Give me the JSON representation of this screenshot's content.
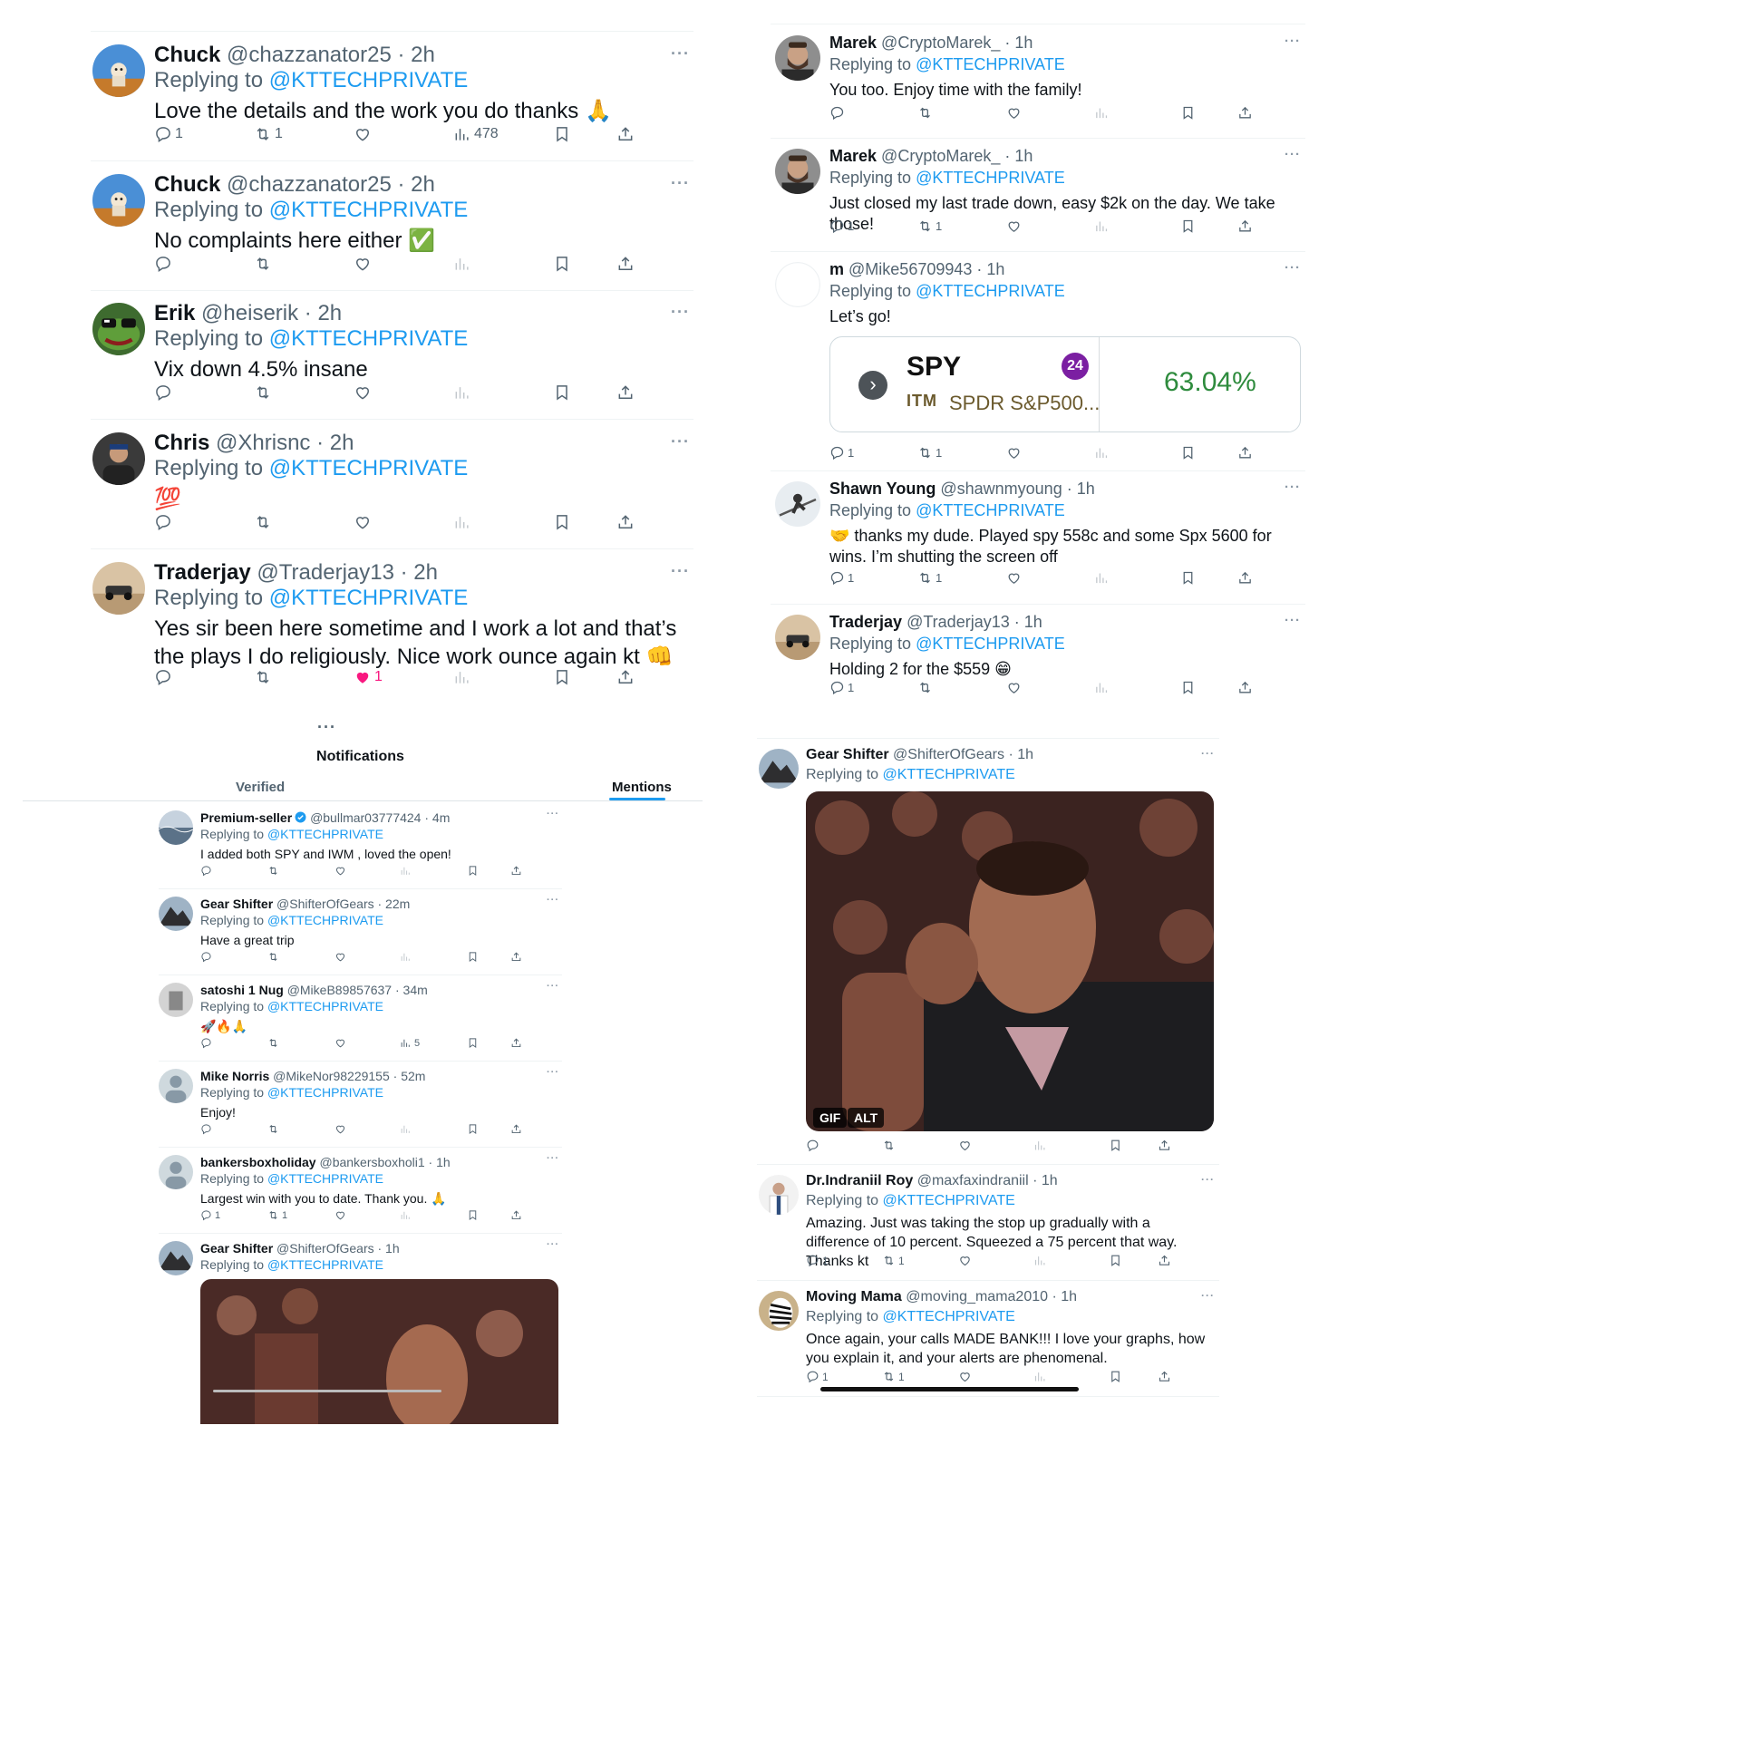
{
  "reply_prefix": "Replying to",
  "mention": "@KTTECHPRIVATE",
  "left_top": [
    {
      "name": "Chuck",
      "handle": "@chazzanator25 · 2h",
      "text": "Love the details and the work you do thanks 🙏",
      "replies": "1",
      "reposts": "1",
      "likes": "",
      "views": "478"
    },
    {
      "name": "Chuck",
      "handle": "@chazzanator25 · 2h",
      "text": "No complaints here either ✅",
      "replies": "",
      "reposts": "",
      "likes": "",
      "views": ""
    },
    {
      "name": "Erik",
      "handle": "@heiserik · 2h",
      "text": "Vix down 4.5% insane",
      "replies": "",
      "reposts": "",
      "likes": "",
      "views": ""
    },
    {
      "name": "Chris",
      "handle": "@Xhrisnc · 2h",
      "text": "💯",
      "replies": "",
      "reposts": "",
      "likes": "",
      "views": ""
    },
    {
      "name": "Traderjay",
      "handle": "@Traderjay13 · 2h",
      "text": "Yes sir been here sometime and I work a lot and that’s the plays I do religiously. Nice work ounce again kt 👊",
      "replies": "",
      "reposts": "",
      "likes": "1",
      "views": ""
    }
  ],
  "right_top": [
    {
      "name": "Marek",
      "handle": "@CryptoMarek_ · 1h",
      "text": "You too. Enjoy time with the family!",
      "replies": "",
      "reposts": "",
      "likes": "",
      "views": ""
    },
    {
      "name": "Marek",
      "handle": "@CryptoMarek_ · 1h",
      "text": "Just closed my last trade down, easy $2k on the day. We take those!",
      "replies": "1",
      "reposts": "1",
      "likes": "",
      "views": ""
    },
    {
      "name": "m",
      "handle": "@Mike56709943 · 1h",
      "text": "Let’s go!",
      "replies": "1",
      "reposts": "1",
      "likes": "",
      "views": ""
    },
    {
      "name": "Shawn Young",
      "handle": "@shawnmyoung · 1h",
      "text": "🤝 thanks my dude. Played spy 558c and some Spx 5600 for wins. I’m shutting the screen off",
      "replies": "1",
      "reposts": "1",
      "likes": "",
      "views": ""
    },
    {
      "name": "Traderjay",
      "handle": "@Traderjay13 · 1h",
      "text": "Holding 2 for the $559 😁",
      "replies": "1",
      "reposts": "",
      "likes": "",
      "views": ""
    }
  ],
  "spy_card": {
    "ticker": "SPY",
    "badge": "24",
    "itm": "ITM",
    "desc": "SPDR S&P500...",
    "pct": "63.04%"
  },
  "notifications": {
    "title": "Notifications",
    "tabs": [
      "Verified",
      "Mentions"
    ],
    "active_tab": "Mentions"
  },
  "bottom_left": [
    {
      "name": "Premium-seller",
      "handle": "@bullmar03777424 · 4m",
      "text": "I added both SPY and IWM , loved the open!",
      "replies": "",
      "reposts": "",
      "views": "",
      "verified": true
    },
    {
      "name": "Gear Shifter",
      "handle": "@ShifterOfGears · 22m",
      "text": "Have a great trip",
      "replies": "",
      "reposts": "",
      "views": ""
    },
    {
      "name": "satoshi 1 Nug",
      "handle": "@MikeB89857637 · 34m",
      "text": "🚀🔥🙏",
      "replies": "",
      "reposts": "",
      "views": "5"
    },
    {
      "name": "Mike Norris",
      "handle": "@MikeNor98229155 · 52m",
      "text": "Enjoy!",
      "replies": "",
      "reposts": "",
      "views": ""
    },
    {
      "name": "bankersboxholiday",
      "handle": "@bankersboxholi1 · 1h",
      "text": "Largest win with you to date. Thank you. 🙏",
      "replies": "1",
      "reposts": "1",
      "views": ""
    },
    {
      "name": "Gear Shifter",
      "handle": "@ShifterOfGears · 1h",
      "text": "",
      "replies": "",
      "reposts": "",
      "views": ""
    }
  ],
  "bottom_right": [
    {
      "name": "Gear Shifter",
      "handle": "@ShifterOfGears · 1h",
      "text": "",
      "replies": "",
      "reposts": "",
      "views": ""
    },
    {
      "name": "Dr.Indraniil Roy",
      "handle": "@maxfaxindraniil · 1h",
      "text": "Amazing. Just was taking the stop up gradually with a difference of 10 percent. Squeezed a 75 percent that way. Thanks kt",
      "replies": "1",
      "reposts": "1",
      "views": ""
    },
    {
      "name": "Moving Mama",
      "handle": "@moving_mama2010 · 1h",
      "text": "Once again, your calls MADE BANK!!!  I love your graphs, how you explain it, and your alerts are phenomenal.",
      "replies": "1",
      "reposts": "1",
      "views": ""
    }
  ],
  "gif_badges": {
    "gif": "GIF",
    "alt": "ALT"
  },
  "more_glyph": "···",
  "colors": {
    "accent": "#1d9bf0",
    "like": "#f91880",
    "muted": "#536471",
    "green": "#2e8b3d",
    "purple": "#7b1fa2"
  }
}
